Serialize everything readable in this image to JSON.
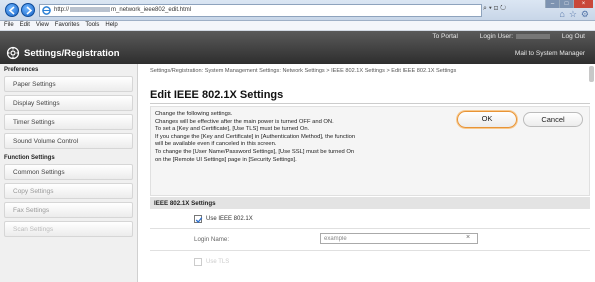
{
  "browser": {
    "address": "http://",
    "address_tail": "m_network_ieee802_edit.html",
    "tools": "⌕ ▾ ⊡ ↻",
    "menu": [
      "File",
      "Edit",
      "View",
      "Favorites",
      "Tools",
      "Help"
    ],
    "window_buttons": [
      "–",
      "□",
      "×"
    ]
  },
  "header": {
    "portal_link": "To Portal",
    "login_user_label": "Login User:",
    "logout_link": "Log Out",
    "title": "Settings/Registration",
    "mail_link": "Mail to System Manager"
  },
  "sidebar": {
    "preferences_heading": "Preferences",
    "preferences_items": [
      "Paper Settings",
      "Display Settings",
      "Timer Settings",
      "Sound Volume Control"
    ],
    "function_heading": "Function Settings",
    "function_items": [
      "Common Settings",
      "Copy Settings",
      "Fax Settings",
      "Scan Settings"
    ]
  },
  "main": {
    "breadcrumb": "Settings/Registration: System Management Settings: Network Settings > IEEE 802.1X Settings > Edit IEEE 802.1X Settings",
    "title": "Edit IEEE 802.1X Settings",
    "info_lines": [
      "Change the following settings.",
      "Changes will be effective after the main power is turned OFF and ON.",
      "To set a [Key and Certificate], [Use TLS] must be turned On.",
      "If you change the [Key and Certificate] in [Authentication Method], the function",
      "will be available even if canceled in this screen.",
      "To change the [User Name/Password Settings], [Use SSL] must be turned On",
      "on the [Remote UI Settings] page in [Security Settings]."
    ],
    "ok_label": "OK",
    "cancel_label": "Cancel",
    "section_header": "IEEE 802.1X Settings",
    "use_ieee_label": "Use IEEE 802.1X",
    "use_ieee_checked": true,
    "login_name_label": "Login Name:",
    "login_name_value": "example",
    "use_tls_label": "Use TLS"
  },
  "colors": {
    "header_bg": "#3a3a3a",
    "ok_border": "#e89436",
    "sidebar_bg": "#f0f0f0"
  }
}
